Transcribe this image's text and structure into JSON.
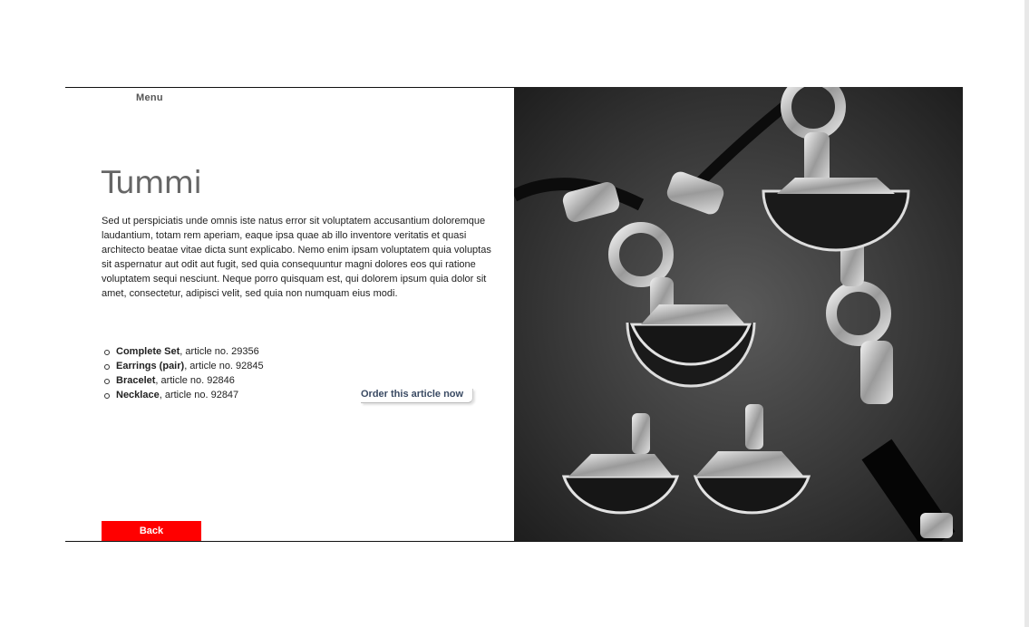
{
  "nav": {
    "menu_label": "Menu"
  },
  "product": {
    "title": "Tummi",
    "description": "Sed ut perspiciatis unde omnis iste natus error sit voluptatem accusantium doloremque laudantium, totam rem aperiam, eaque ipsa quae ab illo inventore veritatis et quasi architecto beatae vitae dicta sunt explicabo. Nemo enim ipsam voluptatem quia voluptas sit aspernatur aut odit aut fugit, sed quia consequuntur magni dolores eos qui ratione voluptatem sequi nesciunt. Neque porro quisquam est, qui dolorem ipsum quia dolor sit amet, consectetur, adipisci velit, sed quia non numquam eius modi.",
    "articles": [
      {
        "name": "Complete Set",
        "detail": ", article no. 29356"
      },
      {
        "name": "Earrings (pair)",
        "detail": ", article no. 92845"
      },
      {
        "name": "Bracelet",
        "detail": ", article no. 92846"
      },
      {
        "name": "Necklace",
        "detail": ", article no. 92847"
      }
    ],
    "order_label": "Order this article now"
  },
  "actions": {
    "back_label": "Back"
  },
  "colors": {
    "back_button": "#ff0000",
    "order_link": "#3a4a63",
    "photo_bg": "#2a2a2a"
  }
}
